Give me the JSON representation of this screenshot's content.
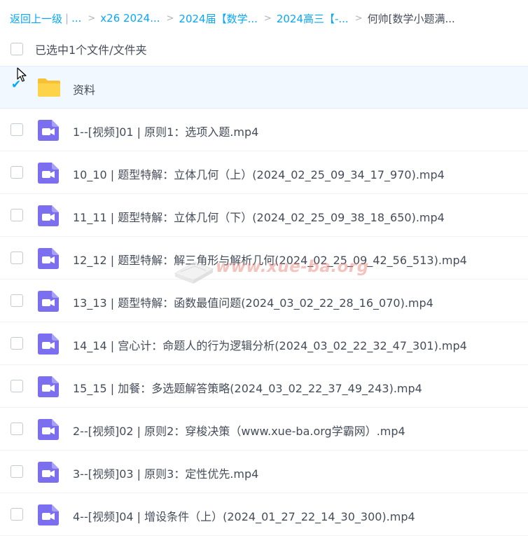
{
  "breadcrumb": {
    "back": "返回上一级",
    "divider": "|",
    "ellipsis": "...",
    "items": [
      "x26 2024...",
      "2024届【数学...",
      "2024高三【-...",
      "何帅[数学小题满..."
    ]
  },
  "selection": {
    "text": "已选中1个文件/文件夹"
  },
  "files": [
    {
      "name": "资料",
      "type": "folder",
      "selected": true
    },
    {
      "name": "1--[视频]01 | 原则1：选项入题.mp4",
      "type": "video",
      "selected": false
    },
    {
      "name": "10_10 | 题型特解：立体几何（上）(2024_02_25_09_34_17_970).mp4",
      "type": "video",
      "selected": false
    },
    {
      "name": "11_11 | 题型特解：立体几何（下）(2024_02_25_09_38_18_650).mp4",
      "type": "video",
      "selected": false
    },
    {
      "name": "12_12 | 题型特解：解三角形与解析几何(2024_02_25_09_42_56_513).mp4",
      "type": "video",
      "selected": false
    },
    {
      "name": "13_13 | 题型特解：函数最值问题(2024_03_02_22_28_16_070).mp4",
      "type": "video",
      "selected": false
    },
    {
      "name": "14_14 | 宫心计：命题人的行为逻辑分析(2024_03_02_22_32_47_301).mp4",
      "type": "video",
      "selected": false
    },
    {
      "name": "15_15 | 加餐：多选题解答策略(2024_03_02_22_37_49_243).mp4",
      "type": "video",
      "selected": false
    },
    {
      "name": "2--[视频]02 | 原则2：穿梭决策（www.xue-ba.org学霸网）.mp4",
      "type": "video",
      "selected": false
    },
    {
      "name": "3--[视频]03 | 原则3：定性优先.mp4",
      "type": "video",
      "selected": false
    },
    {
      "name": "4--[视频]04 | 增设条件（上）(2024_01_27_22_14_30_300).mp4",
      "type": "video",
      "selected": false
    }
  ],
  "watermark": "www.xue-ba.org",
  "colors": {
    "link": "#06a7ff",
    "text": "#454d5a",
    "video_icon": "#7b6ff0",
    "folder_icon": "#fdd34a",
    "selected_row": "#f1f8ff"
  },
  "icons": {
    "folder": "folder-icon",
    "video": "video-file-icon",
    "check": "checkmark-icon",
    "chevron": "chevron-right-icon"
  }
}
